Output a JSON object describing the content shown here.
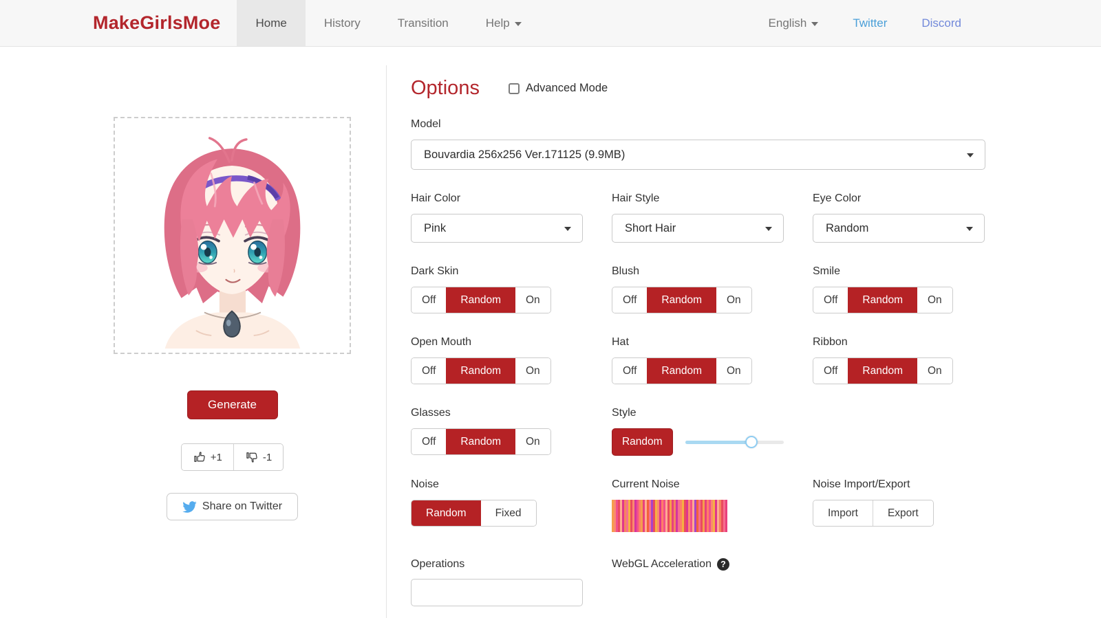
{
  "navbar": {
    "brand": "MakeGirlsMoe",
    "items": [
      {
        "label": "Home",
        "active": true
      },
      {
        "label": "History",
        "active": false
      },
      {
        "label": "Transition",
        "active": false
      },
      {
        "label": "Help",
        "active": false,
        "has_caret": true
      }
    ],
    "language": "English",
    "links": [
      {
        "label": "Twitter",
        "color": "#4a9fd8"
      },
      {
        "label": "Discord",
        "color": "#7289da"
      }
    ]
  },
  "left_panel": {
    "generate": "Generate",
    "upvote": "+1",
    "downvote": "-1",
    "share": "Share on Twitter",
    "character": {
      "hair_color": "#e87e96",
      "hair_shadow": "#dd6e87",
      "headband_color": "#7a57c9",
      "eye_color": "#2f9fb0",
      "skin_color": "#fdf0e8"
    }
  },
  "options": {
    "title": "Options",
    "advanced_mode": "Advanced Mode",
    "model_label": "Model",
    "model_value": "Bouvardia 256x256 Ver.171125 (9.9MB)",
    "selects": [
      {
        "label": "Hair Color",
        "value": "Pink"
      },
      {
        "label": "Hair Style",
        "value": "Short Hair"
      },
      {
        "label": "Eye Color",
        "value": "Random"
      }
    ],
    "toggles": [
      {
        "label": "Dark Skin",
        "off": "Off",
        "mid": "Random",
        "on": "On",
        "selected": "Random"
      },
      {
        "label": "Blush",
        "off": "Off",
        "mid": "Random",
        "on": "On",
        "selected": "Random"
      },
      {
        "label": "Smile",
        "off": "Off",
        "mid": "Random",
        "on": "On",
        "selected": "Random"
      },
      {
        "label": "Open Mouth",
        "off": "Off",
        "mid": "Random",
        "on": "On",
        "selected": "Random"
      },
      {
        "label": "Hat",
        "off": "Off",
        "mid": "Random",
        "on": "On",
        "selected": "Random"
      },
      {
        "label": "Ribbon",
        "off": "Off",
        "mid": "Random",
        "on": "On",
        "selected": "Random"
      },
      {
        "label": "Glasses",
        "off": "Off",
        "mid": "Random",
        "on": "On",
        "selected": "Random"
      }
    ],
    "style": {
      "label": "Style",
      "button": "Random",
      "slider_percent": 67
    },
    "noise": {
      "label": "Noise",
      "random": "Random",
      "fixed": "Fixed",
      "selected": "Random"
    },
    "current_noise": {
      "label": "Current Noise",
      "bar_colors": [
        "#f59e4c",
        "#fa8a6e",
        "#f2508a",
        "#ea4b5f",
        "#ffab91",
        "#e0368c",
        "#f4845f",
        "#f76d8e",
        "#f5b043",
        "#ea4b5f",
        "#fa8a6e",
        "#d5359f",
        "#f2508a",
        "#ff7e67",
        "#f59e4c",
        "#e8417d",
        "#ffab91",
        "#f4623a",
        "#f76d8e",
        "#a844c8",
        "#ea4b5f",
        "#f5b043",
        "#fa8a6e",
        "#e0368c",
        "#ff7e67",
        "#f2508a",
        "#ffab91",
        "#ea4b5f",
        "#f59e4c",
        "#e8417d",
        "#f4845f",
        "#d5359f",
        "#f76d8e",
        "#ff7e67",
        "#f5b043",
        "#ea4b5f",
        "#e0368c",
        "#fa8a6e",
        "#f2508a",
        "#ffab91",
        "#a844c8",
        "#f4623a",
        "#f76d8e",
        "#ea4b5f",
        "#f59e4c",
        "#e8417d",
        "#ff7e67",
        "#f2508a",
        "#fa8a6e",
        "#f5b043",
        "#e0368c",
        "#ffab91",
        "#f4845f",
        "#ea4b5f",
        "#f76d8e",
        "#e8417d"
      ]
    },
    "noise_io": {
      "label": "Noise Import/Export",
      "import": "Import",
      "export": "Export"
    },
    "operations_label": "Operations",
    "webgl": {
      "label": "WebGL Acceleration",
      "help_glyph": "?"
    }
  },
  "colors": {
    "accent_red": "#b52225",
    "brand_red": "#b3262c",
    "twitter_blue": "#55acee",
    "discord_blue": "#7289da",
    "slider_fill": "#a9d9f2",
    "navbar_bg": "#f7f7f7",
    "active_tab_bg": "#e8e8e8"
  }
}
